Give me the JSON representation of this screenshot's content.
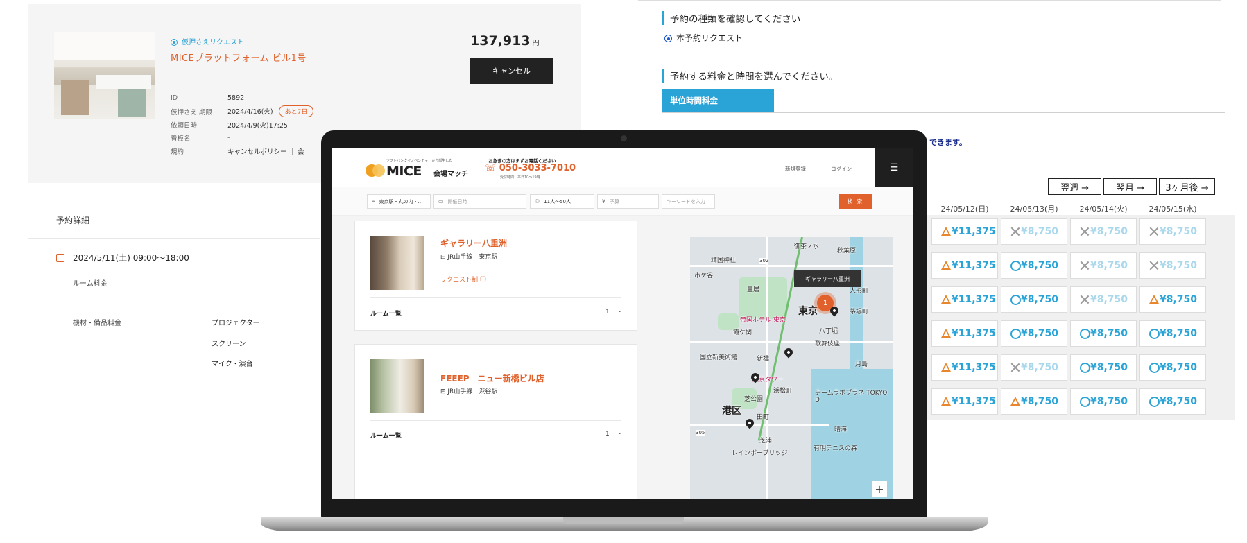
{
  "booking_card": {
    "request_type": "仮押さえリクエスト",
    "title": "MICEプラットフォーム ビル1号",
    "price": "137,913",
    "price_unit": "円",
    "cancel_label": "キャンセル",
    "rows": [
      {
        "label": "ID",
        "value": "5892",
        "badge": ""
      },
      {
        "label": "仮押さえ 期限",
        "value": "2024/4/16(火)",
        "badge": "あと7日"
      },
      {
        "label": "依頼日時",
        "value": "2024/4/9(火)17:25",
        "badge": ""
      },
      {
        "label": "看板名",
        "value": "-",
        "badge": ""
      },
      {
        "label": "規約",
        "value": "キャンセルポリシー ｜ 会",
        "badge": ""
      }
    ]
  },
  "reservation_detail": {
    "heading": "予約詳細",
    "datetime": "2024/5/11(土)  09:00〜18:00",
    "room_fee_label": "ルーム料金",
    "equipment_label": "機材・備品料金",
    "equipment": [
      "プロジェクター",
      "スクリーン",
      "マイク・演台"
    ]
  },
  "booking_panel": {
    "type_heading": "予約の種類を確認してください",
    "type_option": "本予約リクエスト",
    "price_heading": "予約する料金と時間を選んでください。",
    "tab_label": "単位時間料金",
    "notice": "できます。",
    "nav": [
      "翌週 →",
      "翌月 →",
      "3ヶ月後 →"
    ],
    "dates": [
      "24/05/12(日)",
      "24/05/13(月)",
      "24/05/14(火)",
      "24/05/15(水)"
    ],
    "rows": [
      [
        {
          "s": "tri",
          "p": "¥11,375"
        },
        {
          "s": "cross",
          "p": "¥8,750"
        },
        {
          "s": "cross",
          "p": "¥8,750"
        },
        {
          "s": "cross",
          "p": "¥8,750"
        }
      ],
      [
        {
          "s": "tri",
          "p": "¥11,375"
        },
        {
          "s": "circ",
          "p": "¥8,750"
        },
        {
          "s": "cross",
          "p": "¥8,750"
        },
        {
          "s": "cross",
          "p": "¥8,750"
        }
      ],
      [
        {
          "s": "tri",
          "p": "¥11,375"
        },
        {
          "s": "circ",
          "p": "¥8,750"
        },
        {
          "s": "cross",
          "p": "¥8,750"
        },
        {
          "s": "tri",
          "p": "¥8,750"
        }
      ],
      [
        {
          "s": "tri",
          "p": "¥11,375"
        },
        {
          "s": "circ",
          "p": "¥8,750"
        },
        {
          "s": "circ",
          "p": "¥8,750"
        },
        {
          "s": "circ",
          "p": "¥8,750"
        }
      ],
      [
        {
          "s": "tri",
          "p": "¥11,375"
        },
        {
          "s": "cross",
          "p": "¥8,750"
        },
        {
          "s": "circ",
          "p": "¥8,750"
        },
        {
          "s": "circ",
          "p": "¥8,750"
        }
      ],
      [
        {
          "s": "tri",
          "p": "¥11,375"
        },
        {
          "s": "tri",
          "p": "¥8,750"
        },
        {
          "s": "circ",
          "p": "¥8,750"
        },
        {
          "s": "circ",
          "p": "¥8,750"
        }
      ]
    ]
  },
  "site": {
    "logo_sub": "ソフトバンクイノベンチャーから誕生した",
    "logo": "MICE",
    "logo_right": "会場マッチ",
    "phone_caption": "お急ぎの方はまずお電話ください",
    "phone": "050-3033-7010",
    "phone_hours": "受付時間：平日10〜19時",
    "register": "新規登録",
    "login": "ログイン",
    "menu_icon": "☰",
    "search": {
      "station": "東京駅・丸の内・…",
      "date_placeholder": "開催日時",
      "people": "11人〜50人",
      "budget_placeholder": "予算",
      "keyword_placeholder": "キーワードを入力",
      "button": "検 索"
    },
    "venues": [
      {
        "name": "ギャラリー八重洲",
        "line": "JR山手線　東京駅",
        "request": "リクエスト制",
        "room_list": "ルーム一覧",
        "count": "1"
      },
      {
        "name": "FEEEP　ニュー新橋ビル店",
        "line": "JR山手線　渋谷駅",
        "room_list": "ルーム一覧",
        "count": "1"
      }
    ],
    "map": {
      "tooltip": "ギャラリー八重洲",
      "cluster_count": "1",
      "labels": {
        "ochanomizu": "御茶ノ水",
        "akihabara": "秋葉原",
        "yasukuni": "靖国神社",
        "ichigaya": "市ケ谷",
        "kokyo": "皇居",
        "ningyocho": "人形町",
        "tokyo": "東京",
        "kayabacho": "茅場町",
        "imperial": "帝国ホテル 東京",
        "kasumigaseki": "霞ケ関",
        "hatchobori": "八丁堀",
        "kabukiza": "歌舞伎座",
        "art": "国立新美術館",
        "shinbashi": "新橋",
        "tsukishima": "月島",
        "tower": "東京タワー",
        "hamamatsucho": "浜松町",
        "shiba": "芝公園",
        "team": "チームラボプラネ TOKYO D",
        "minato": "港区",
        "tamachi": "田町",
        "harumi": "晴海",
        "shibaura": "芝浦",
        "tennis": "有明テニスの森",
        "rainbow": "レインボーブリッジ",
        "r302": "302",
        "r305": "305"
      }
    }
  }
}
